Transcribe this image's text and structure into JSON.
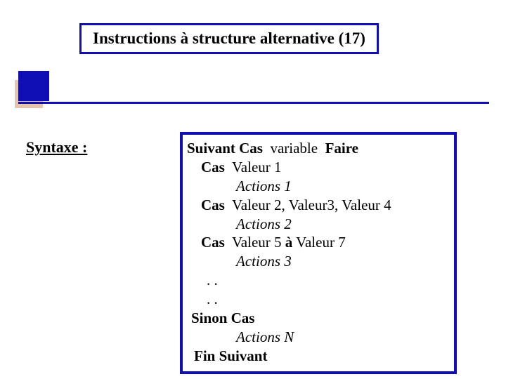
{
  "title": "Instructions à structure alternative (17)",
  "syntaxe_label": "Syntaxe :",
  "code": {
    "l1": {
      "kw1": "Suivant Cas",
      "rest": "  variable  ",
      "kw2": "Faire"
    },
    "l2": {
      "kw": "Cas",
      "rest": "  Valeur 1"
    },
    "l3": "Actions 1",
    "l4": {
      "kw": "Cas",
      "rest": "  Valeur 2, Valeur3, Valeur 4"
    },
    "l5": "Actions 2",
    "l6": {
      "kw": "Cas",
      "rest": "  Valeur 5 ",
      "kw2": "à",
      "rest2": " Valeur 7"
    },
    "l7": "Actions 3",
    "dots1": ". .",
    "dots2": ". .",
    "sinon": "Sinon Cas",
    "l8": "Actions N",
    "fin": "Fin Suivant"
  }
}
